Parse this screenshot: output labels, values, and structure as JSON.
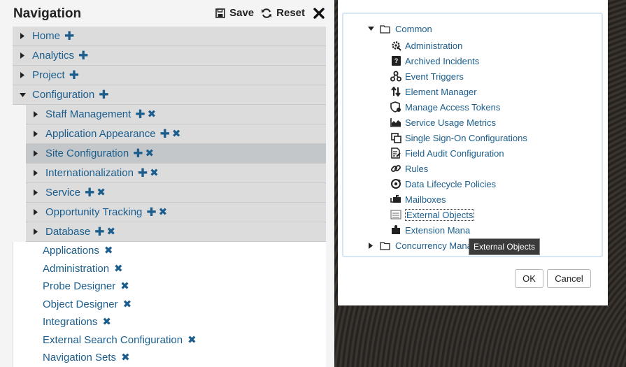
{
  "nav": {
    "title": "Navigation",
    "save_label": "Save",
    "reset_label": "Reset",
    "top_items": [
      {
        "label": "Home"
      },
      {
        "label": "Analytics"
      },
      {
        "label": "Project"
      },
      {
        "label": "Configuration"
      }
    ],
    "config_items": [
      {
        "label": "Staff Management"
      },
      {
        "label": "Application Appearance"
      },
      {
        "label": "Site Configuration"
      },
      {
        "label": "Internationalization"
      },
      {
        "label": "Service"
      },
      {
        "label": "Opportunity Tracking"
      },
      {
        "label": "Database"
      }
    ],
    "leaf_items": [
      {
        "label": "Applications"
      },
      {
        "label": "Administration"
      },
      {
        "label": "Probe Designer"
      },
      {
        "label": "Object Designer"
      },
      {
        "label": "Integrations"
      },
      {
        "label": "External Search Configuration"
      },
      {
        "label": "Navigation Sets"
      }
    ],
    "selected": "Site Configuration"
  },
  "dialog": {
    "folder_common": "Common",
    "items": [
      {
        "label": "Administration",
        "icon": "gear-wrench-icon"
      },
      {
        "label": "Archived Incidents",
        "icon": "archive-question-icon"
      },
      {
        "label": "Event Triggers",
        "icon": "trigger-icon"
      },
      {
        "label": "Element Manager",
        "icon": "sort-arrows-icon"
      },
      {
        "label": "Manage Access Tokens",
        "icon": "shield-token-icon"
      },
      {
        "label": "Service Usage Metrics",
        "icon": "area-chart-icon"
      },
      {
        "label": "Single Sign-On Configurations",
        "icon": "copy-pages-icon"
      },
      {
        "label": "Field Audit Configuration",
        "icon": "document-edit-icon"
      },
      {
        "label": "Rules",
        "icon": "link-icon"
      },
      {
        "label": "Data Lifecycle Policies",
        "icon": "lifecycle-icon"
      },
      {
        "label": "Mailboxes",
        "icon": "mailbox-icon"
      },
      {
        "label": "External Objects",
        "icon": "list-window-icon"
      },
      {
        "label": "Extension Mana",
        "icon": "puzzle-icon"
      }
    ],
    "folder_concurrency": "Concurrency Manager",
    "tooltip": "External Objects",
    "ok_label": "OK",
    "cancel_label": "Cancel"
  }
}
